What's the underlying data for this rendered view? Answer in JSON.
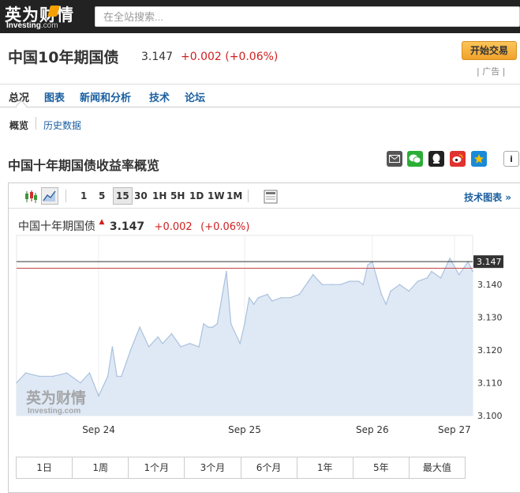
{
  "header": {
    "logo_cn": "英为财情",
    "logo_en": "Investing",
    "logo_com": ".com",
    "search_placeholder": "在全站搜索..."
  },
  "instrument": {
    "title": "中国10年期国债",
    "price": "3.147",
    "change": "+0.002 (+0.06%)",
    "trade_button": "开始交易",
    "ad_label": "| 广告 |"
  },
  "nav": {
    "tabs": [
      {
        "label": "总况"
      },
      {
        "label": "图表"
      },
      {
        "label": "新闻和分析"
      },
      {
        "label": "技术"
      },
      {
        "label": "论坛"
      }
    ]
  },
  "subnav": {
    "items": [
      {
        "label": "概览"
      },
      {
        "label": "历史数据"
      }
    ]
  },
  "section": {
    "title": "中国十年期国债收益率概览",
    "share_icons": [
      "mail-icon",
      "wechat-icon",
      "qq-icon",
      "weibo-icon",
      "qzone-icon",
      "info-icon"
    ]
  },
  "chart_toolbar": {
    "intervals": [
      "1",
      "5",
      "15",
      "30",
      "1H",
      "5H",
      "1D",
      "1W",
      "1M"
    ],
    "selected_interval": "15",
    "tech_link": "技术图表 »"
  },
  "colors": {
    "up": "#d02020",
    "link": "#1a5fa0",
    "area_fill": "#dfe9f5",
    "area_line": "#a9c1de",
    "current_line": "#333333",
    "prev_close_line": "#c44444"
  },
  "chart_data": {
    "type": "area",
    "legend_name": "中国十年期国债",
    "legend_price": "3.147",
    "legend_change": "+0.002",
    "legend_pct": "(+0.06%)",
    "current_value_label": "3.147",
    "current_value": 3.147,
    "previous_close": 3.145,
    "ylim": [
      3.1,
      3.155
    ],
    "y_ticks": [
      3.11,
      3.12,
      3.13,
      3.14
    ],
    "y_tick_labels": [
      "3.110",
      "3.120",
      "3.130",
      "3.140"
    ],
    "y_bottom_label": "3.100",
    "x_tick_labels": [
      "Sep 24",
      "Sep 25",
      "Sep 26",
      "Sep 27"
    ],
    "x_ticks": [
      0.18,
      0.5,
      0.78,
      0.96
    ],
    "x": [
      0.0,
      0.02,
      0.05,
      0.08,
      0.11,
      0.14,
      0.16,
      0.18,
      0.2,
      0.21,
      0.22,
      0.23,
      0.24,
      0.25,
      0.27,
      0.29,
      0.31,
      0.32,
      0.34,
      0.36,
      0.38,
      0.4,
      0.41,
      0.42,
      0.43,
      0.44,
      0.46,
      0.47,
      0.49,
      0.5,
      0.51,
      0.52,
      0.53,
      0.55,
      0.56,
      0.58,
      0.6,
      0.62,
      0.64,
      0.65,
      0.67,
      0.69,
      0.71,
      0.73,
      0.75,
      0.76,
      0.77,
      0.78,
      0.79,
      0.8,
      0.81,
      0.82,
      0.84,
      0.86,
      0.88,
      0.9,
      0.91,
      0.93,
      0.95,
      0.97,
      0.99,
      1.0
    ],
    "values": [
      3.11,
      3.113,
      3.112,
      3.112,
      3.113,
      3.11,
      3.113,
      3.106,
      3.112,
      3.121,
      3.112,
      3.112,
      3.116,
      3.12,
      3.127,
      3.121,
      3.124,
      3.122,
      3.125,
      3.121,
      3.122,
      3.121,
      3.128,
      3.127,
      3.127,
      3.128,
      3.144,
      3.128,
      3.122,
      3.128,
      3.136,
      3.134,
      3.136,
      3.137,
      3.135,
      3.136,
      3.136,
      3.137,
      3.141,
      3.143,
      3.14,
      3.14,
      3.14,
      3.141,
      3.141,
      3.14,
      3.146,
      3.147,
      3.142,
      3.137,
      3.134,
      3.138,
      3.14,
      3.138,
      3.141,
      3.142,
      3.144,
      3.142,
      3.148,
      3.143,
      3.147,
      3.144
    ]
  },
  "watermark": {
    "cn": "英为财情",
    "en": "Investing",
    "com": ".com"
  },
  "periods": [
    {
      "label": "1日"
    },
    {
      "label": "1周"
    },
    {
      "label": "1个月"
    },
    {
      "label": "3个月"
    },
    {
      "label": "6个月"
    },
    {
      "label": "1年"
    },
    {
      "label": "5年"
    },
    {
      "label": "最大值"
    }
  ]
}
